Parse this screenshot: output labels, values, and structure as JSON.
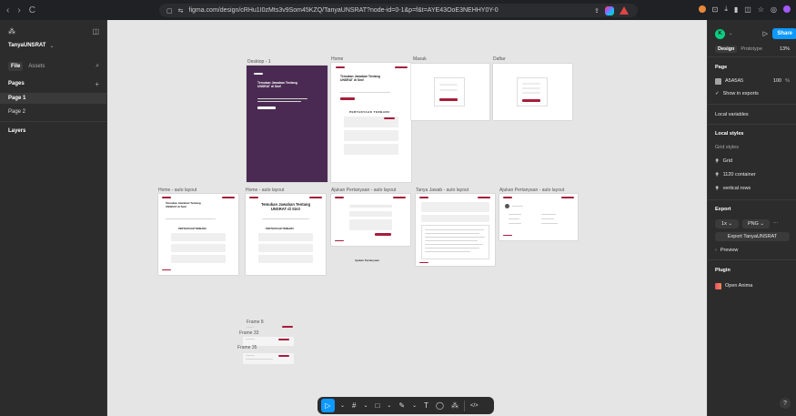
{
  "browser": {
    "back": "‹",
    "forward": "›",
    "reload": "C",
    "url": "figma.com/design/cRHu1I0zMts3v9Som45KZQ/TanyaUNSRAT?node-id=0-1&p=f&t=AYE43OoE3NEHHY0Y-0",
    "colors": {
      "ext1": "#e8883a",
      "ext2": "#e45b5b",
      "ext3": "#a259ff"
    }
  },
  "left_panel": {
    "file_name": "TanyaUNSRAT",
    "file_tab": "File",
    "assets_tab": "Assets",
    "pages_header": "Pages",
    "pages": [
      "Page 1",
      "Page 2"
    ],
    "layers_header": "Layers"
  },
  "frames": {
    "desktop": "Desktop - 1",
    "home": "Home",
    "masuk": "Masuk",
    "daftar": "Daftar",
    "home_auto1": "Home - auto layout",
    "home_auto2": "Home - auto layout",
    "ajukan_auto1": "Ajukan Pertanyaan - auto layout",
    "tanya_jawab": "Tanya Jawab - auto layout",
    "ajukan_auto2": "Ajukan Pertanyaan - auto layout",
    "frame8": "Frame 8",
    "frame33": "Frame 33",
    "frame35": "Frame 35",
    "desktop_title": "Temukan Jawaban Tentang UNSRAT di Sini!",
    "home_title": "Temukan Jawaban Tentang UNSRAT di Sini!",
    "home2_title": "Temukan Jawaban Tentang UNSRAT di Sini!",
    "section": "PERTANYAAN TERBARU",
    "ajukan_caption": "Ajukan Pertanyaan"
  },
  "toolbar": {
    "move": "▷",
    "frame": "#",
    "shape": "□",
    "pen": "✎",
    "text": "T",
    "comment": "◯",
    "actions": "⁂",
    "dev": "</>"
  },
  "right_panel": {
    "avatar": "K",
    "share": "Share",
    "tab_design": "Design",
    "tab_prototype": "Prototype",
    "zoom": "13%",
    "page_header": "Page",
    "page_color": "A5A5A5",
    "page_opacity": "100",
    "page_opacity_unit": "%",
    "show_exports": "Show in exports",
    "local_variables": "Local variables",
    "local_styles": "Local styles",
    "grid_styles": "Grid styles",
    "grid_items": [
      "Grid",
      "1120 container",
      "vertical rows"
    ],
    "export_header": "Export",
    "export_scale": "1x",
    "export_format": "PNG",
    "export_button": "Export TanyaUNSRAT",
    "preview": "Preview",
    "plugin_header": "Plugin",
    "plugin_name": "Open Anima",
    "help": "?"
  }
}
